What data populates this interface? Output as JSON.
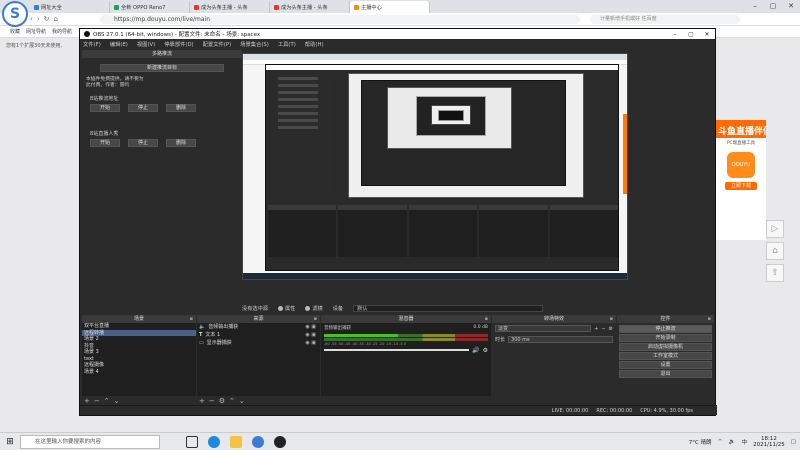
{
  "browser": {
    "tabs": [
      {
        "label": "网址大全",
        "active": false
      },
      {
        "label": "全新 OPPO Reno7",
        "active": false
      },
      {
        "label": "成为头条主播 - 头条",
        "active": false
      },
      {
        "label": "成为头条主播 - 头条",
        "active": false
      },
      {
        "label": "主播中心",
        "active": true
      }
    ],
    "url": "https://mp.douyu.com/live/main",
    "search_placeholder": "计量新增手机或好 任百度",
    "bookmarks": [
      "收藏",
      "网址导航",
      "我的导航"
    ],
    "notice": "您有1个扩展30天未使用,"
  },
  "obs": {
    "title": "OBS 27.0.1 (64-bit, windows) - 配置文件: 未命名 - 场景: spacex",
    "menu": [
      "文件(F)",
      "编辑(E)",
      "视图(V)",
      "停靠部件(D)",
      "配置文件(P)",
      "场景集合(S)",
      "工具(T)",
      "帮助(H)"
    ],
    "multi_panel": {
      "header": "多路推流",
      "new_target": "新建推流目标",
      "hint": "本插件免费提供，请不要为此付费。作者：雷鸣",
      "group1": "B站推流地址",
      "group2": "B站直播人秀",
      "buttons": [
        "开始",
        "停止",
        "删除"
      ]
    },
    "source_toolbar": {
      "no_source": "没有选中源",
      "properties": "属性",
      "filters": "滤镜",
      "device_label": "设备",
      "device_value": "默认"
    },
    "scenes": {
      "header": "场景",
      "items": [
        "双平台直播",
        "远程转播",
        "场景 2",
        "抖音",
        "场景 3",
        "text",
        "远程摄像",
        "场景 4"
      ],
      "selected": 1
    },
    "sources": {
      "header": "来源",
      "items": [
        {
          "label": "音频输出捕获",
          "icon": "speaker-icon"
        },
        {
          "label": "文本 1",
          "icon": "text-icon"
        },
        {
          "label": "显示器捕获",
          "icon": "monitor-icon"
        }
      ]
    },
    "mixer": {
      "header": "混音器",
      "channel": "音频输出捕获",
      "level": "0.0 dB",
      "ticks": "-60 -55 -50 -45 -40 -35 -30 -25 -20 -15 -10 -5 0"
    },
    "transitions": {
      "header": "转场特效",
      "type": "淡变",
      "duration_label": "时长",
      "duration_value": "300 ms"
    },
    "controls": {
      "header": "控件",
      "buttons": [
        "停止推流",
        "开始录制",
        "启动虚拟摄像机",
        "工作室模式",
        "设置",
        "退出"
      ]
    },
    "status": {
      "live": "LIVE: 00:00:00",
      "rec": "REC: 00:00:00",
      "cpu": "CPU: 4.9%, 30.00 fps"
    }
  },
  "promo": {
    "headline": "斗鱼直播伴侣",
    "subtitle": "PC端直播工具",
    "logo_text": "DOUYU",
    "download": "立即下载"
  },
  "taskbar": {
    "search_placeholder": "在这里输入你要搜索的内容",
    "weather": "7°C 晴朗",
    "lang": "中",
    "time": "18:12",
    "date": "2021/11/25"
  },
  "colors": {
    "obs_bg": "#2b2b2b",
    "accent_orange": "#ff6b00",
    "selected_row": "#48608a",
    "browser_blue": "#3a7bd5"
  }
}
